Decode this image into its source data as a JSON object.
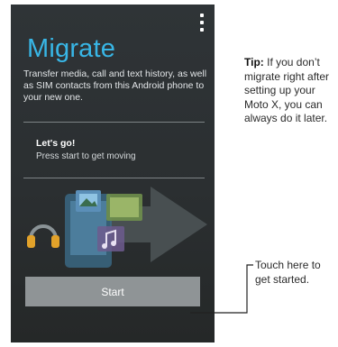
{
  "app": {
    "title": "Migrate",
    "description": "Transfer media, call and text history, as well as SIM contacts from this Android phone to your new one.",
    "card": {
      "title": "Let's go!",
      "subtitle": "Press start to get moving"
    },
    "start_label": "Start",
    "accent_color": "#38b6e6"
  },
  "icons": [
    "overflow-menu-icon",
    "headphones-icon",
    "phone-icon",
    "photo-icon",
    "video-icon",
    "music-icon",
    "arrow-right-icon"
  ],
  "annotations": {
    "tip_label": "Tip:",
    "tip_text": "If you don’t migrate right after setting up your Moto X, you can always do it later.",
    "start_callout": "Touch here to get started."
  }
}
